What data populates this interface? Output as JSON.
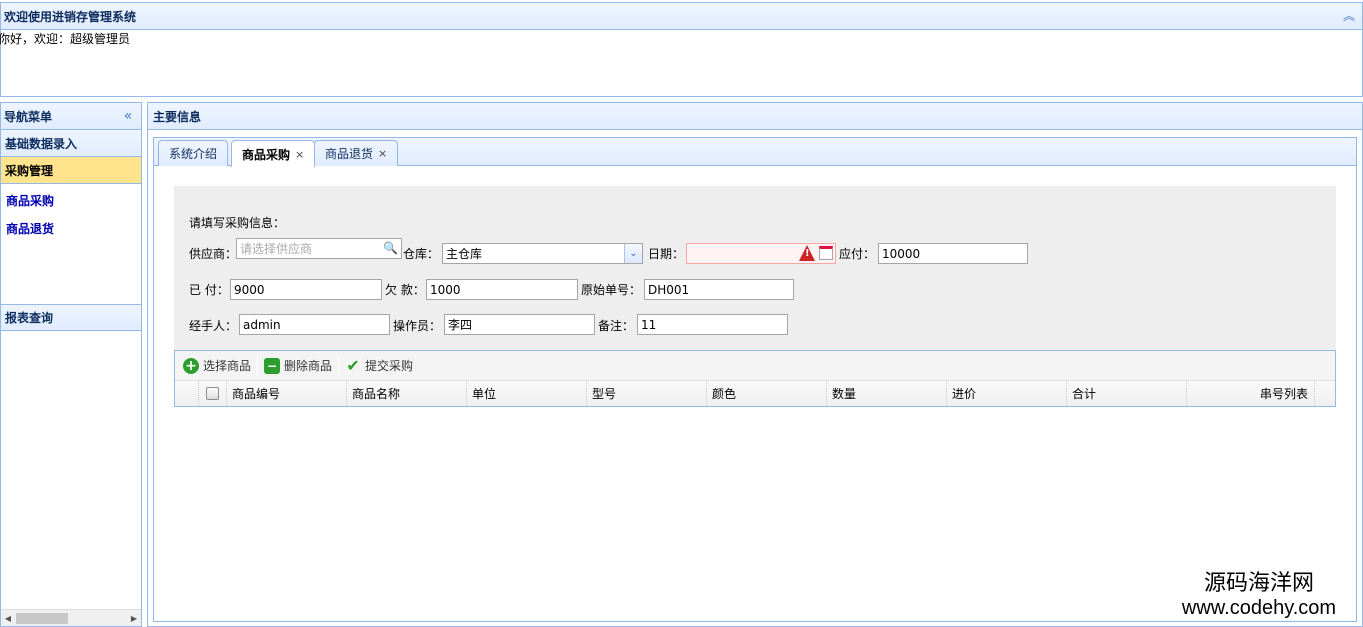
{
  "header": {
    "title": "欢迎使用进销存管理系统",
    "welcome": "你好，欢迎：超级管理员"
  },
  "nav": {
    "title": "导航菜单",
    "sections": [
      {
        "label": "基础数据录入"
      },
      {
        "label": "采购管理"
      },
      {
        "label": "报表查询"
      }
    ],
    "items": [
      {
        "label": "商品采购"
      },
      {
        "label": "商品退货"
      }
    ]
  },
  "main": {
    "title": "主要信息",
    "tabs": [
      {
        "label": "系统介绍"
      },
      {
        "label": "商品采购",
        "close": "×"
      },
      {
        "label": "商品退货",
        "close": "×"
      }
    ]
  },
  "form": {
    "heading": "请填写采购信息：",
    "supplier_label": "供应商：",
    "supplier_placeholder": "请选择供应商",
    "warehouse_label": "仓库：",
    "warehouse_value": "主仓库",
    "date_label": "日期：",
    "date_value": "",
    "payable_label": "应付：",
    "payable_value": "10000",
    "paid_label": "已 付：",
    "paid_value": "9000",
    "owed_label": "欠 款：",
    "owed_value": "1000",
    "orig_no_label": "原始单号：",
    "orig_no_value": "DH001",
    "handler_label": "经手人：",
    "handler_value": "admin",
    "operator_label": "操作员：",
    "operator_value": "李四",
    "remark_label": "备注：",
    "remark_value": "11"
  },
  "toolbar": {
    "select_label": "选择商品",
    "delete_label": "删除商品",
    "submit_label": "提交采购"
  },
  "grid": {
    "columns": [
      "商品编号",
      "商品名称",
      "单位",
      "型号",
      "颜色",
      "数量",
      "进价",
      "合计",
      "串号列表"
    ]
  },
  "watermark": {
    "line1": "源码海洋网",
    "line2": "www.codehy.com"
  },
  "colors": {
    "border": "#95b8e7",
    "selected_section": "#ffe48d",
    "menu_link": "#0000b0"
  }
}
